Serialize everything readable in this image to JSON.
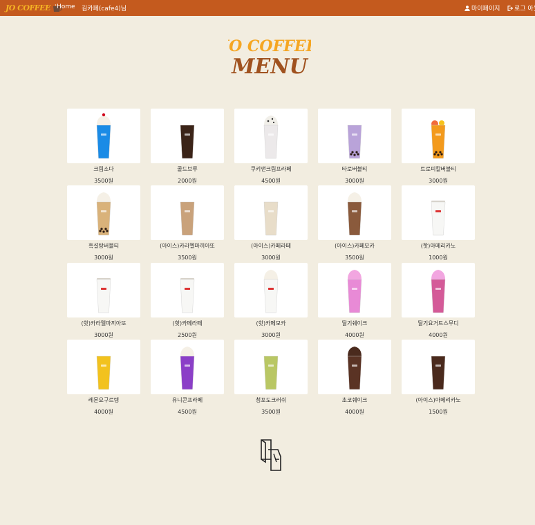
{
  "nav": {
    "brand": "JO COFFEE",
    "home": "Home",
    "user": "김카페(cafe4)님",
    "mypage": "마이페이지",
    "logout": "로그 아웃"
  },
  "header": {
    "logo_top": "JO COFFEE",
    "logo_bottom": "MENU"
  },
  "menu": [
    {
      "name": "크림소다",
      "price": "3500원",
      "liquid": "#1a8be6",
      "top": "cream"
    },
    {
      "name": "콜드브루",
      "price": "2000원",
      "liquid": "#3b2418",
      "top": "none"
    },
    {
      "name": "쿠키앤크림프라페",
      "price": "4500원",
      "liquid": "#ece9ea",
      "top": "cookie"
    },
    {
      "name": "타로버블티",
      "price": "3000원",
      "liquid": "#b9a3d9",
      "top": "none"
    },
    {
      "name": "트로피칼버블티",
      "price": "3000원",
      "liquid": "#f39a1c",
      "top": "fruit"
    },
    {
      "name": "흑설탕버블티",
      "price": "3000원",
      "liquid": "#d9b27a",
      "top": "cream"
    },
    {
      "name": "(아이스)카라멜마끼아또",
      "price": "3500원",
      "liquid": "#c9a27b",
      "top": "none"
    },
    {
      "name": "(아이스)카페라떼",
      "price": "3000원",
      "liquid": "#e8ddc9",
      "top": "none"
    },
    {
      "name": "(아이스)카페모카",
      "price": "3500원",
      "liquid": "#8a5a3c",
      "top": "cream"
    },
    {
      "name": "(핫)아메리카노",
      "price": "1000원",
      "liquid": "#ffffff",
      "top": "hot"
    },
    {
      "name": "(핫)카라멜마끼아또",
      "price": "3000원",
      "liquid": "#ffffff",
      "top": "hot"
    },
    {
      "name": "(핫)카페라떼",
      "price": "2500원",
      "liquid": "#ffffff",
      "top": "hot"
    },
    {
      "name": "(핫)카페모카",
      "price": "3000원",
      "liquid": "#ffffff",
      "top": "cream"
    },
    {
      "name": "딸기쉐이크",
      "price": "4000원",
      "liquid": "#e88ad6",
      "top": "pink"
    },
    {
      "name": "딸기요거트스무디",
      "price": "4000원",
      "liquid": "#d45a98",
      "top": "pink"
    },
    {
      "name": "레몬요구르텡",
      "price": "4000원",
      "liquid": "#f2c21e",
      "top": "none"
    },
    {
      "name": "유니콘프라페",
      "price": "4500원",
      "liquid": "#8b3fc7",
      "top": "cream"
    },
    {
      "name": "청포도크러쉬",
      "price": "3500원",
      "liquid": "#b9c764",
      "top": "none"
    },
    {
      "name": "초코쉐이크",
      "price": "4000원",
      "liquid": "#5a3324",
      "top": "choco"
    },
    {
      "name": "(아이스)아메리카노",
      "price": "1500원",
      "liquid": "#4a2a1d",
      "top": "none"
    }
  ],
  "colors": {
    "navbar": "#c45a1e",
    "background": "#f2ede0",
    "logo_orange": "#f5a623",
    "logo_brown": "#a0521f"
  }
}
